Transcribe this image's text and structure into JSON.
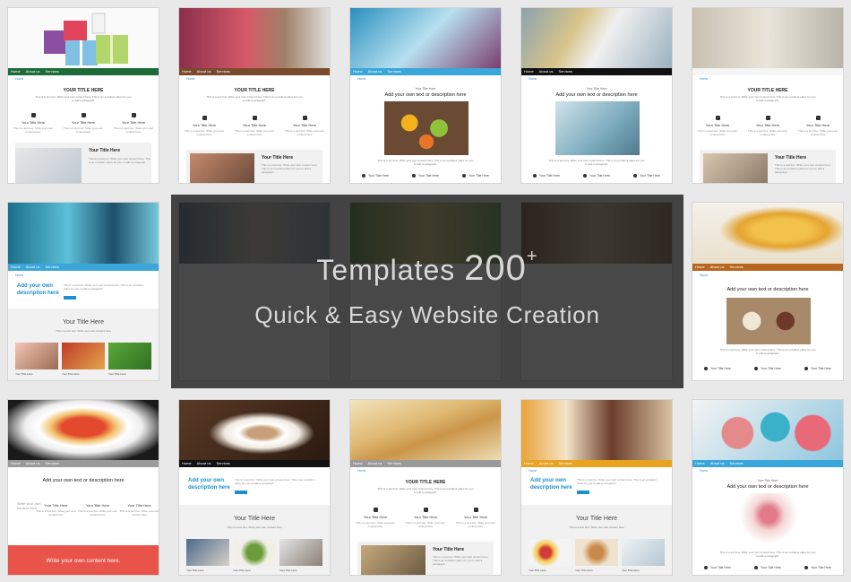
{
  "overlay": {
    "title": "Templates",
    "count": "200",
    "plus": "+",
    "subtitle": "Quick & Easy Website Creation"
  },
  "template_text": {
    "nav": [
      "Home",
      "About us",
      "Services"
    ],
    "crumb": "Home",
    "title_caps": "YOUR TITLE HERE",
    "title_small": "Your Title Here",
    "title_large": "Your Title Here",
    "add_text": "Add your own text or description here",
    "add_text_short": "Add your own description here",
    "body": "This is a text box. Write your own content here. This is an excellent place for you to add a paragraph.",
    "feature_desc": "This is a text box. Write your own content here",
    "write_content": "Write your own content here.",
    "your_own_title": "Your Title Here",
    "write_own_content": "Write your own content here"
  },
  "colors": {
    "green_nav": "#1e6b3a",
    "brown_nav": "#7a4a2c",
    "blue_nav": "#3ba6d9",
    "black_nav": "#111111",
    "gray_nav": "#9a9a9a",
    "orange_nav": "#b8661f",
    "red_footer": "#e8534a",
    "accent_blue": "#1b8ed0"
  }
}
